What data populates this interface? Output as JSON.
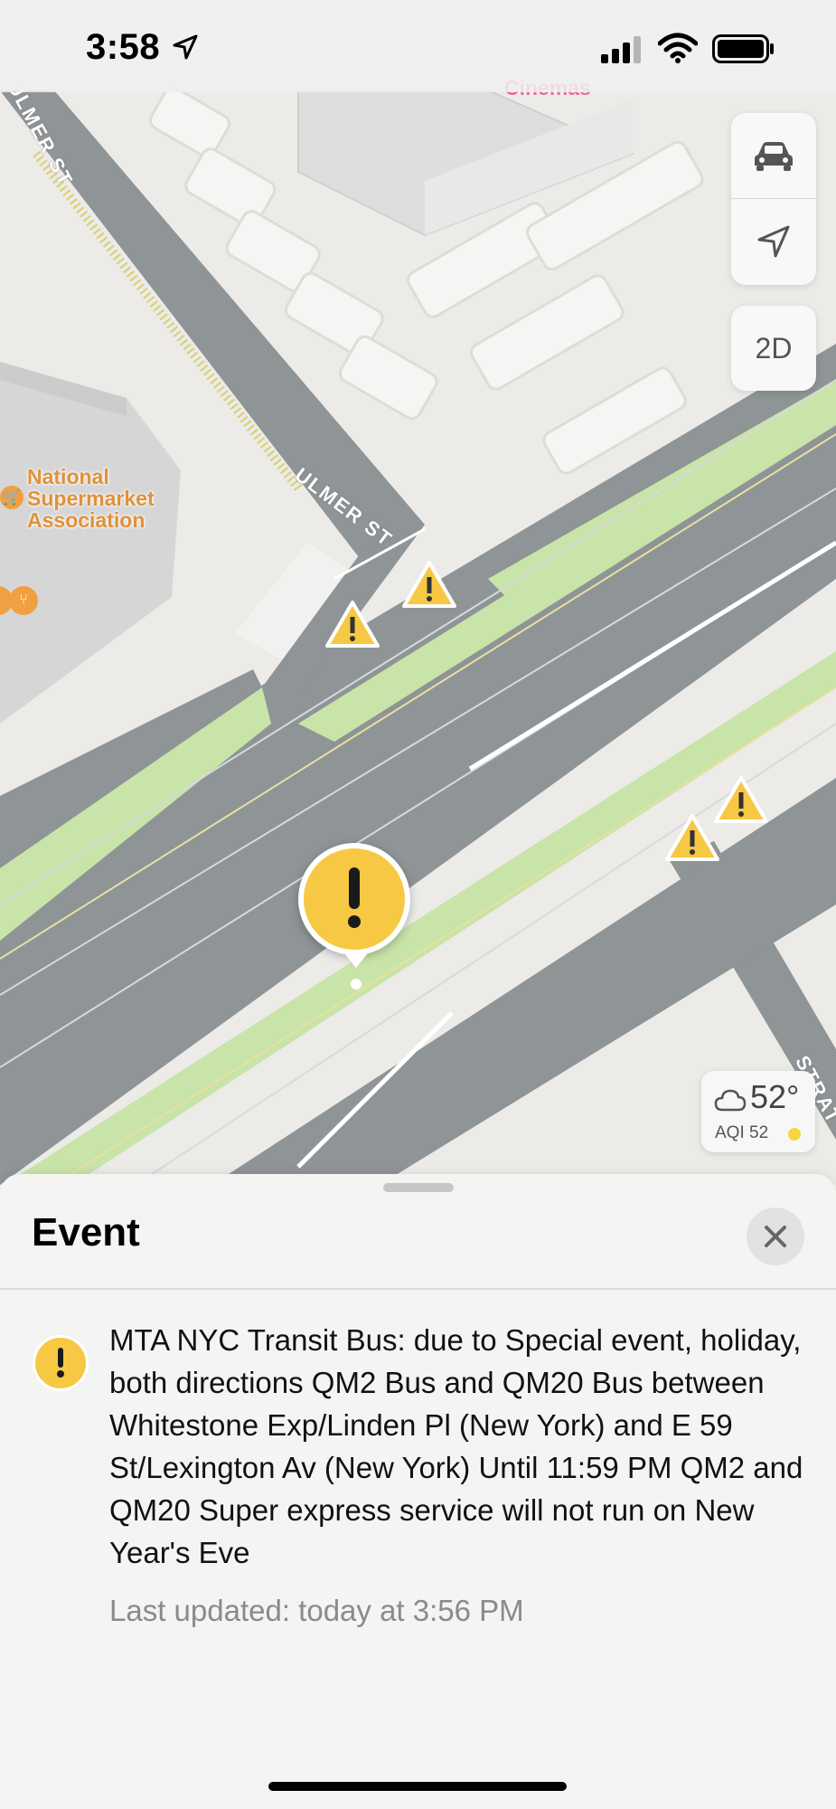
{
  "status_bar": {
    "time": "3:58",
    "icons": [
      "location-arrow-icon",
      "cellular-signal-icon",
      "wifi-icon",
      "battery-icon"
    ]
  },
  "map": {
    "poi": {
      "supermarket_line1": "National",
      "supermarket_line2": "Supermarket",
      "supermarket_line3": "Association",
      "cinemas": "Cinemas"
    },
    "streets": {
      "ulmer_main": "ULMER ST",
      "ulmer_top": "ULMER ST",
      "strat": "STRAT"
    },
    "controls": {
      "driving_icon": "car-icon",
      "tracking_icon": "location-arrow-icon",
      "view_mode": "2D"
    },
    "weather": {
      "temperature": "52°",
      "aqi_label": "AQI 52",
      "condition_icon": "cloud-icon"
    },
    "colors": {
      "warning": "#f7c844",
      "road": "#8f9496",
      "median": "#c8e4a8"
    }
  },
  "sheet": {
    "title": "Event",
    "description": "MTA NYC Transit Bus: due to Special event, holiday, both directions QM2 Bus and QM20 Bus between Whitestone Exp/Linden Pl (New York) and E 59 St/Lexington Av (New York) Until 11:59 PM QM2 and QM20 Super express service will not run on New Year's Eve",
    "last_updated": "Last updated: today at 3:56 PM"
  }
}
